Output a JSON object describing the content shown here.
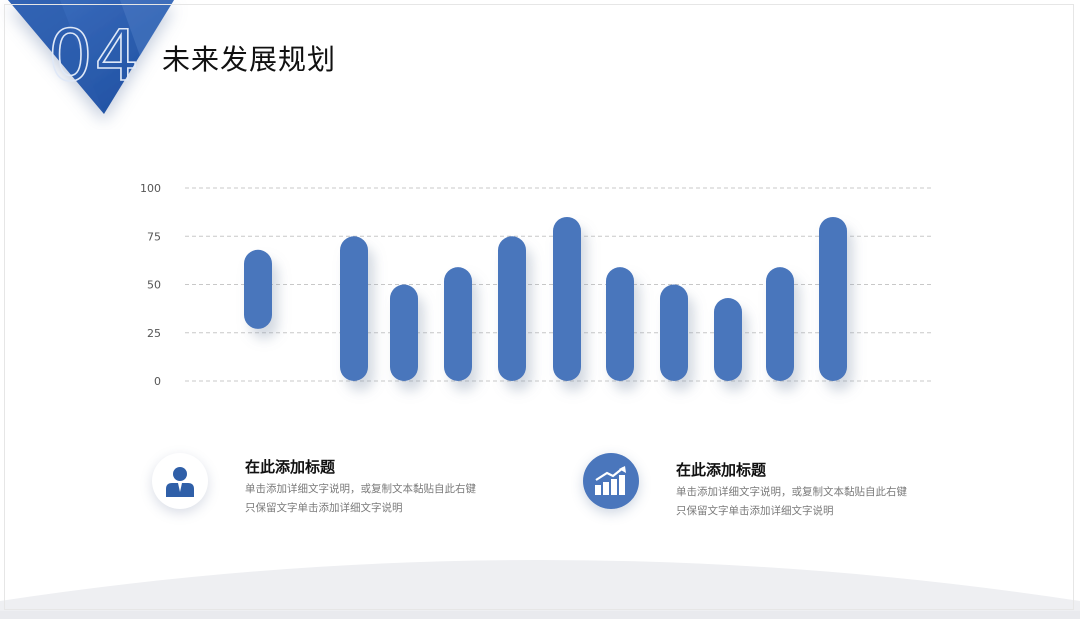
{
  "section_number": "04",
  "title": "未来发展规划",
  "colors": {
    "accent": "#4a76bc",
    "accent_dark": "#1f4fa0",
    "grid": "#c8c8c8",
    "tick_text": "#555555"
  },
  "chart_data": {
    "type": "bar",
    "style": "floating-range",
    "categories": [
      "",
      "",
      "",
      "",
      "",
      "",
      "",
      "",
      "",
      "",
      "",
      ""
    ],
    "ranges": [
      [
        27,
        68
      ],
      null,
      [
        0,
        75
      ],
      [
        0,
        50
      ],
      [
        0,
        59
      ],
      [
        0,
        75
      ],
      [
        0,
        85
      ],
      [
        0,
        59
      ],
      [
        0,
        50
      ],
      [
        0,
        43
      ],
      [
        0,
        59
      ],
      [
        0,
        85
      ]
    ],
    "yticks": [
      0,
      25,
      50,
      75,
      100
    ],
    "ytick_labels": [
      "0",
      "25",
      "50",
      "75",
      "100"
    ],
    "ylim": [
      0,
      100
    ],
    "grid": true,
    "grid_style": "dashed"
  },
  "info_blocks": [
    {
      "icon": "user-icon",
      "title": "在此添加标题",
      "line1": "单击添加详细文字说明，或复制文本黏贴自此右键",
      "line2": "只保留文字单击添加详细文字说明"
    },
    {
      "icon": "bar-chart-growth-icon",
      "title": "在此添加标题",
      "line1": "单击添加详细文字说明，或复制文本黏贴自此右键",
      "line2": "只保留文字单击添加详细文字说明"
    }
  ]
}
